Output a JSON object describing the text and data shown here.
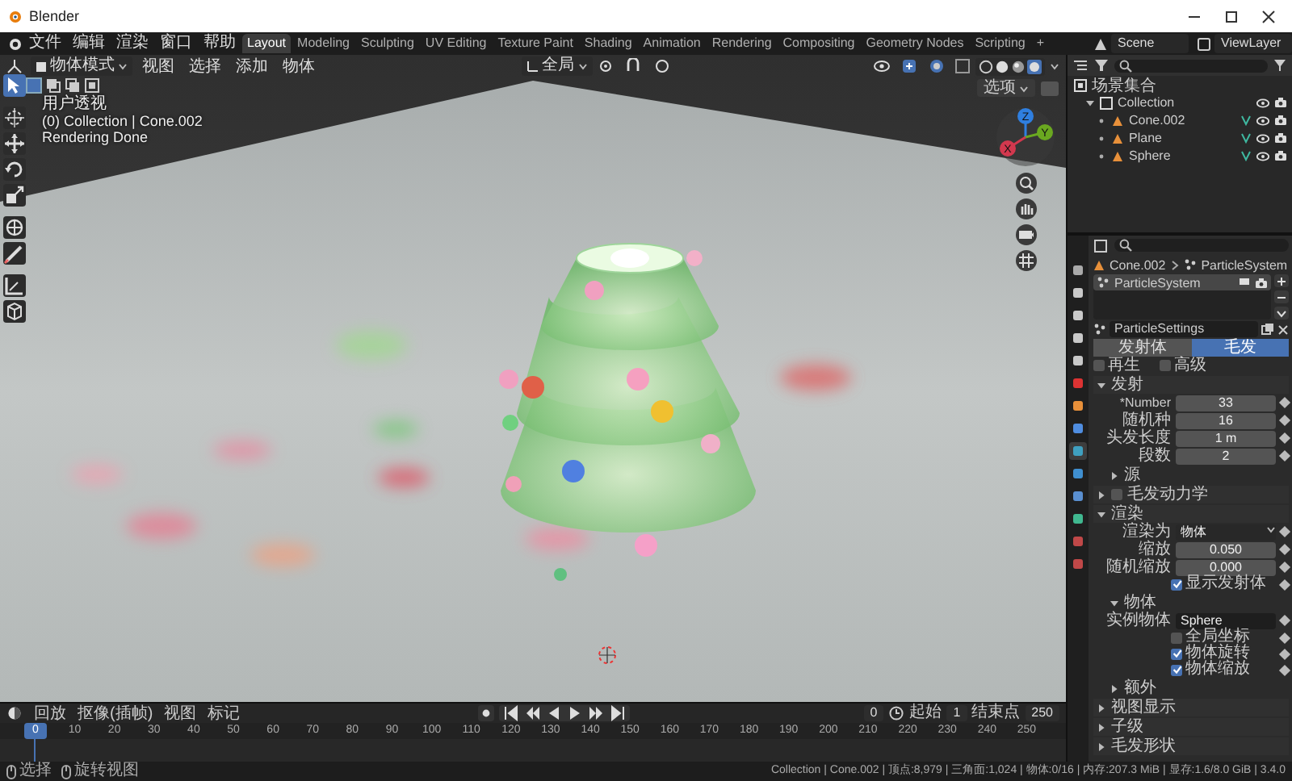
{
  "window": {
    "title": "Blender"
  },
  "menu": [
    "文件",
    "编辑",
    "渲染",
    "窗口",
    "帮助"
  ],
  "workspaces": [
    {
      "label": "Layout",
      "selected": true
    },
    {
      "label": "Modeling",
      "selected": false
    },
    {
      "label": "Sculpting",
      "selected": false
    },
    {
      "label": "UV Editing",
      "selected": false
    },
    {
      "label": "Texture Paint",
      "selected": false
    },
    {
      "label": "Shading",
      "selected": false
    },
    {
      "label": "Animation",
      "selected": false
    },
    {
      "label": "Rendering",
      "selected": false
    },
    {
      "label": "Compositing",
      "selected": false
    },
    {
      "label": "Geometry Nodes",
      "selected": false
    },
    {
      "label": "Scripting",
      "selected": false
    }
  ],
  "add_workspace": "+",
  "scene": "Scene",
  "view_layer": "ViewLayer",
  "viewport": {
    "mode": "物体模式",
    "menus": [
      "视图",
      "选择",
      "添加",
      "物体"
    ],
    "orientation": "全局",
    "options": "选项",
    "overlay_lines": [
      "用户透视",
      "(0) Collection | Cone.002",
      "Rendering Done"
    ],
    "tools": [
      {
        "kind": "select",
        "selected": true
      },
      {
        "kind": "cursor",
        "selected": false
      },
      {
        "kind": "move",
        "selected": false
      },
      {
        "kind": "rotate",
        "selected": false
      },
      {
        "kind": "scale",
        "selected": false
      },
      {
        "kind": "transform",
        "selected": false
      },
      {
        "kind": "annotate",
        "selected": false
      },
      {
        "kind": "measure",
        "selected": false
      },
      {
        "kind": "add-cube",
        "selected": false
      }
    ],
    "gizmo_axes": [
      {
        "label": "Z",
        "color": "#2f7fe0"
      },
      {
        "label": "Y",
        "color": "#6aa820"
      },
      {
        "label": "X",
        "color": "#d2384e"
      }
    ]
  },
  "outliner": {
    "root": "场景集合",
    "items": [
      {
        "name": "Collection",
        "children": [
          {
            "name": "Cone.002"
          },
          {
            "name": "Plane"
          },
          {
            "name": "Sphere"
          }
        ]
      }
    ]
  },
  "properties": {
    "tabs": [
      {
        "kind": "tool",
        "selected": false
      },
      {
        "kind": "render",
        "selected": false
      },
      {
        "kind": "output",
        "selected": false
      },
      {
        "kind": "view",
        "selected": false
      },
      {
        "kind": "scene",
        "selected": false
      },
      {
        "kind": "world",
        "selected": false
      },
      {
        "kind": "object",
        "selected": false
      },
      {
        "kind": "modifier",
        "selected": false
      },
      {
        "kind": "particles",
        "selected": true
      },
      {
        "kind": "physics",
        "selected": false
      },
      {
        "kind": "constraints",
        "selected": false
      },
      {
        "kind": "data",
        "selected": false
      },
      {
        "kind": "material",
        "selected": false
      },
      {
        "kind": "texture",
        "selected": false
      }
    ],
    "object": "Cone.002",
    "system": "ParticleSystem",
    "systems": [
      {
        "name": "ParticleSystem",
        "selected": true
      }
    ],
    "settings": "ParticleSettings",
    "type_tabs": [
      {
        "label": "发射体",
        "selected": false
      },
      {
        "label": "毛发",
        "selected": true
      }
    ],
    "toggles": [
      {
        "label": "再生",
        "checked": false
      },
      {
        "label": "高级",
        "checked": false
      }
    ],
    "panels": [
      {
        "title": "发射",
        "expanded": true,
        "rows": [
          {
            "kind": "number",
            "label": "*Number",
            "value": "33"
          },
          {
            "kind": "number",
            "label": "随机种",
            "value": "16"
          },
          {
            "kind": "number",
            "label": "头发长度",
            "value": "1 m"
          },
          {
            "kind": "number",
            "label": "段数",
            "value": "2"
          }
        ],
        "children": [
          {
            "title": "源",
            "expanded": false
          }
        ]
      },
      {
        "title": "毛发动力学",
        "expanded": false,
        "enabled": false
      },
      {
        "title": "渲染",
        "expanded": true,
        "rows": [
          {
            "kind": "select",
            "label": "渲染为",
            "value": "物体"
          },
          {
            "kind": "number",
            "label": "缩放",
            "value": "0.050"
          },
          {
            "kind": "number",
            "label": "随机缩放",
            "value": "0.000"
          },
          {
            "kind": "check",
            "label": "显示发射体",
            "checked": true
          }
        ],
        "children": [
          {
            "title": "物体",
            "expanded": true,
            "rows": [
              {
                "kind": "object",
                "label": "实例物体",
                "value": "Sphere"
              },
              {
                "kind": "check",
                "label": "全局坐标",
                "checked": false
              },
              {
                "kind": "check",
                "label": "物体旋转",
                "checked": true
              },
              {
                "kind": "check",
                "label": "物体缩放",
                "checked": true
              }
            ]
          },
          {
            "title": "额外",
            "expanded": false
          }
        ]
      },
      {
        "title": "视图显示",
        "expanded": false
      },
      {
        "title": "子级",
        "expanded": false
      },
      {
        "title": "毛发形状",
        "expanded": false
      }
    ]
  },
  "timeline": {
    "menus": [
      "回放",
      "抠像(插帧)",
      "视图",
      "标记"
    ],
    "current_frame": "0",
    "start_label": "起始",
    "start": "1",
    "end_label": "结束点",
    "end": "250",
    "playhead_label": "0",
    "ticks": [
      "10",
      "20",
      "30",
      "40",
      "50",
      "60",
      "70",
      "80",
      "90",
      "100",
      "110",
      "120",
      "130",
      "140",
      "150",
      "160",
      "170",
      "180",
      "190",
      "200",
      "210",
      "220",
      "230",
      "240",
      "250"
    ]
  },
  "status_bar": {
    "hints": [
      "选择",
      "旋转视图"
    ],
    "stats": "Collection | Cone.002 | 顶点:8,979 | 三角面:1,024 | 物体:0/16 | 内存:207.3 MiB | 显存:1.6/8.0 GiB | 3.4.0"
  }
}
